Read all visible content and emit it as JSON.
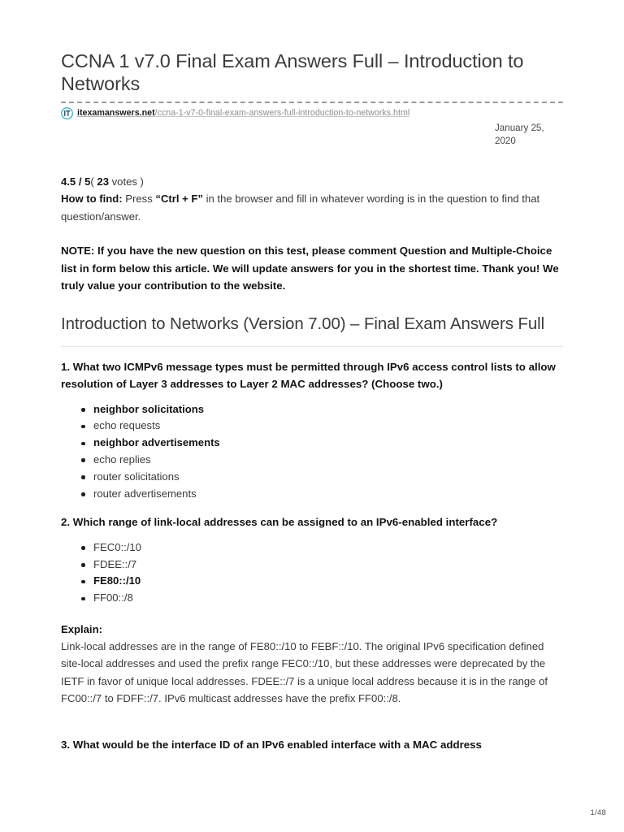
{
  "document": {
    "title": "CCNA 1 v7.0 Final Exam Answers Full – Introduction to Networks",
    "source": {
      "favicon_name": "itexamanswers-logo-icon",
      "domain": "itexamanswers.net",
      "path": "/ccna-1-v7-0-final-exam-answers-full-introduction-to-networks.html"
    },
    "date": "January 25,\n2020",
    "page_number": "1/48"
  },
  "rating": {
    "score": "4.5 / 5",
    "open_paren": "( ",
    "votes_count": "23",
    "votes_label": " votes )"
  },
  "howto": {
    "label": "How to find:",
    "text_before": " Press ",
    "shortcut": "“Ctrl + F”",
    "text_after": " in the browser and fill in whatever wording is in the question to find that question/answer."
  },
  "note": {
    "text": "NOTE: If you have the new question on this test, please comment Question and Multiple-Choice list in form below this article. We will update answers for you in the shortest time. Thank you! We truly value your contribution to the website."
  },
  "section": {
    "heading": "Introduction to Networks (Version 7.00) – Final Exam Answers Full"
  },
  "questions": [
    {
      "number": "1.",
      "text": "1. What two ICMPv6 message types must be permitted through IPv6 access control lists to allow resolution of Layer 3 addresses to Layer 2 MAC addresses? (Choose two.)",
      "choices": [
        {
          "label": "neighbor solicitations",
          "correct": true
        },
        {
          "label": "echo requests",
          "correct": false
        },
        {
          "label": "neighbor advertisements",
          "correct": true
        },
        {
          "label": "echo replies",
          "correct": false
        },
        {
          "label": "router solicitations",
          "correct": false
        },
        {
          "label": "router advertisements",
          "correct": false
        }
      ]
    },
    {
      "number": "2.",
      "text": "2. Which range of link-local addresses can be assigned to an IPv6-enabled interface?",
      "choices": [
        {
          "label": "FEC0::/10",
          "correct": false
        },
        {
          "label": "FDEE::/7",
          "correct": false
        },
        {
          "label": "FE80::/10",
          "correct": true
        },
        {
          "label": "FF00::/8",
          "correct": false
        }
      ],
      "explain": {
        "label": "Explain:",
        "text": "Link-local addresses are in the range of FE80::/10 to FEBF::/10. The original IPv6 specification defined site-local addresses and used the prefix range FEC0::/10, but these addresses were deprecated by the IETF in favor of unique local addresses. FDEE::/7 is a unique local address because it is in the range of FC00::/7 to FDFF::/7. IPv6 multicast addresses have the prefix FF00::/8."
      }
    },
    {
      "number": "3.",
      "text": "3. What would be the interface ID of an IPv6 enabled interface with a MAC address"
    }
  ],
  "colors": {
    "link_domain": "#1b1b1b",
    "link_path": "#8e8e8e",
    "heading": "#3c3c3c",
    "body": "#3a3a3a",
    "bold": "#131313",
    "favicon_teal": "#2bb3c0"
  }
}
